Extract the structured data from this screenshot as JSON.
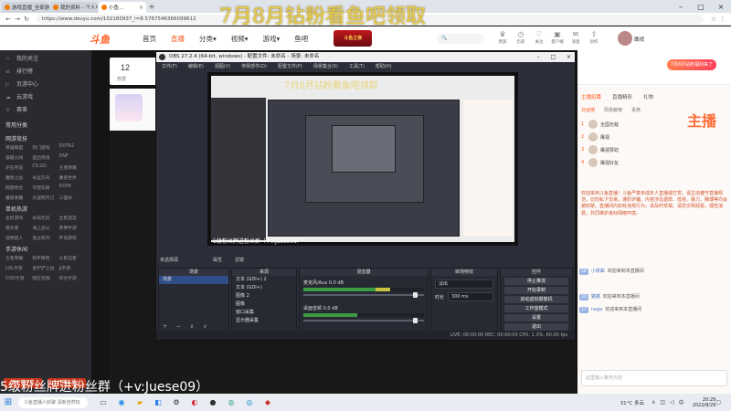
{
  "browser": {
    "tabs": [
      {
        "label": "游戏直播_全部游戏直播_斗鱼直…",
        "active": false
      },
      {
        "label": "我的资料 - 个人中心 - 斗鱼",
        "active": false
      },
      {
        "label": "小鱼…",
        "active": true
      }
    ],
    "url": "https://www.douyu.com/102160937_l=8.5767546366099612"
  },
  "header": {
    "logo": "斗鱼",
    "nav": [
      "首页",
      "直播",
      "分类▾",
      "视频▾",
      "游戏▾",
      "鱼吧"
    ],
    "active_nav": "直播",
    "promo": "斗鱼之夜",
    "icons": [
      {
        "icon": "crown-icon",
        "label": "贵族"
      },
      {
        "icon": "clock-icon",
        "label": "历史"
      },
      {
        "icon": "heart-icon",
        "label": "关注"
      },
      {
        "icon": "gift-icon",
        "label": "客户端"
      },
      {
        "icon": "mail-icon",
        "label": "消息"
      },
      {
        "icon": "upload-icon",
        "label": "创作"
      }
    ],
    "username": "鹰视"
  },
  "sidebar": {
    "items": [
      {
        "icon": "star-icon",
        "label": "我的关注"
      },
      {
        "icon": "list-icon",
        "label": "排行榜"
      },
      {
        "icon": "video-icon",
        "label": "页游中心"
      },
      {
        "icon": "cloud-icon",
        "label": "云游戏"
      },
      {
        "icon": "trophy-icon",
        "label": "赛事"
      }
    ],
    "groups": [
      {
        "title": "常用分类",
        "entries": []
      },
      {
        "title": "网游竞技",
        "entries": [
          "英雄联盟",
          "热门游戏",
          "DOTA2",
          "穿越火线",
          "逃出绝境",
          "DNF",
          "炉石传说",
          "CS:GO",
          "王者荣耀",
          "魔兽之战",
          "命运方舟",
          "魔兽世界",
          "网游综合",
          "守望先锋",
          "DOTA",
          "魔兽争霸",
          "天涯明月刀",
          "三国杀"
        ]
      },
      {
        "title": "单机热游",
        "entries": [
          "主机游戏",
          "永劫无间",
          "全民迷宫",
          "猎鸟者",
          "海上战火",
          "原神手游",
          "怪物猎人",
          "鬼泣系列",
          "怀旧游戏"
        ]
      },
      {
        "title": "手游休闲",
        "entries": [
          "王者荣耀",
          "和平精英",
          "火影忍者",
          "LOL手游",
          "金铲铲之战",
          "JJ手游",
          "COD手游",
          "暗区突围",
          "综合手游"
        ]
      }
    ],
    "btn_download": "客户端下载",
    "btn_open": "开播工具"
  },
  "content": {
    "stat_num": "12",
    "stat_label": "数据"
  },
  "obs": {
    "title": "OBS 27.2.4 (64-bit, windows) - 配置文件: 未命名 - 场景: 未命名",
    "menu": [
      "文件(F)",
      "编辑(E)",
      "视图(V)",
      "停靠部件(D)",
      "配置文件(P)",
      "场景集合(S)",
      "工具(T)",
      "帮助(H)"
    ],
    "preview_overlay": "7月8月钻粉看鱼吧领取",
    "preview_bottom": "5级粉丝牌进粉丝群（+v:Juese09）",
    "scene_label": "未选择源",
    "tab_a": "属性",
    "tab_b": "滤镜",
    "docks": {
      "scenes": {
        "title": "场景",
        "rows": [
          "场景"
        ]
      },
      "sources": {
        "title": "来源",
        "rows": [
          "文本 (GDI+) 2",
          "文本 (GDI+)",
          "图像 2",
          "图像",
          "窗口采集",
          "显示器采集"
        ]
      },
      "mixer": {
        "title": "混音器",
        "channels": [
          {
            "name": "麦克风/Aux",
            "db": "0.0 dB",
            "level": 0.72,
            "volume": 0.95
          },
          {
            "name": "桌面音频",
            "db": "0.0 dB",
            "level": 0.45,
            "volume": 0.95
          }
        ]
      },
      "transitions": {
        "title": "转场特效",
        "effect": "淡出",
        "duration_label": "时长",
        "duration": "300 ms"
      },
      "controls": {
        "title": "控件",
        "buttons": [
          "停止推流",
          "开始录制",
          "启动虚拟摄像机",
          "工作室模式",
          "设置",
          "退出"
        ]
      }
    },
    "status": "LIVE: 00:00:00   REC: 00:00:00   CPU: 1.3%, 60.00 fps"
  },
  "right_panel": {
    "badge": "7月8月钻粉福利来了",
    "tabs": [
      "主播招募",
      "直播精彩",
      "礼物"
    ],
    "active_tab": "主播招募",
    "sub_tabs": [
      "日运榜",
      "周贡献榜",
      "贵族"
    ],
    "active_sub": "日运榜",
    "sub_title": "鹰视最新鹰视打折扣",
    "ranks": [
      {
        "rank": "1",
        "name": "全国无敌"
      },
      {
        "rank": "2",
        "name": "鹰视"
      },
      {
        "rank": "3",
        "name": "鹰视赞助"
      },
      {
        "rank": "4",
        "name": "鹰视好友"
      }
    ],
    "mascot": "主播",
    "notice": "欢迎来到斗鱼直播！斗鱼严禁未成年人直播或打赏，请主动遵守直播规范，切勿私下交易，谨防诈骗。内容涉及烟草、低俗、暴力、赌博等均会被封禁。直播间内如有违规行为，请及时举报。请您文明观看，理性消费，共同维护良好网络环境。",
    "chat": [
      {
        "level": "26",
        "nick": "小夜曲",
        "text": "欢迎来到本直播间"
      },
      {
        "level": "20",
        "nick": "猫猫",
        "text": "欢迎来到本直播间"
      },
      {
        "level": "17",
        "nick": "naga",
        "text": "欢迎来到本直播间"
      }
    ],
    "chat_placeholder": "这里输入聊天内容"
  },
  "overlays": {
    "top": "7月8月钻粉看鱼吧领取",
    "bottom": "5级粉丝牌进粉丝群（+v:Juese09）"
  },
  "taskbar": {
    "search_placeholder": "斗鱼直播人妖聊 清新自然玩",
    "weather": "31°C 多云",
    "time": "20:29",
    "date": "2022/8/29"
  }
}
